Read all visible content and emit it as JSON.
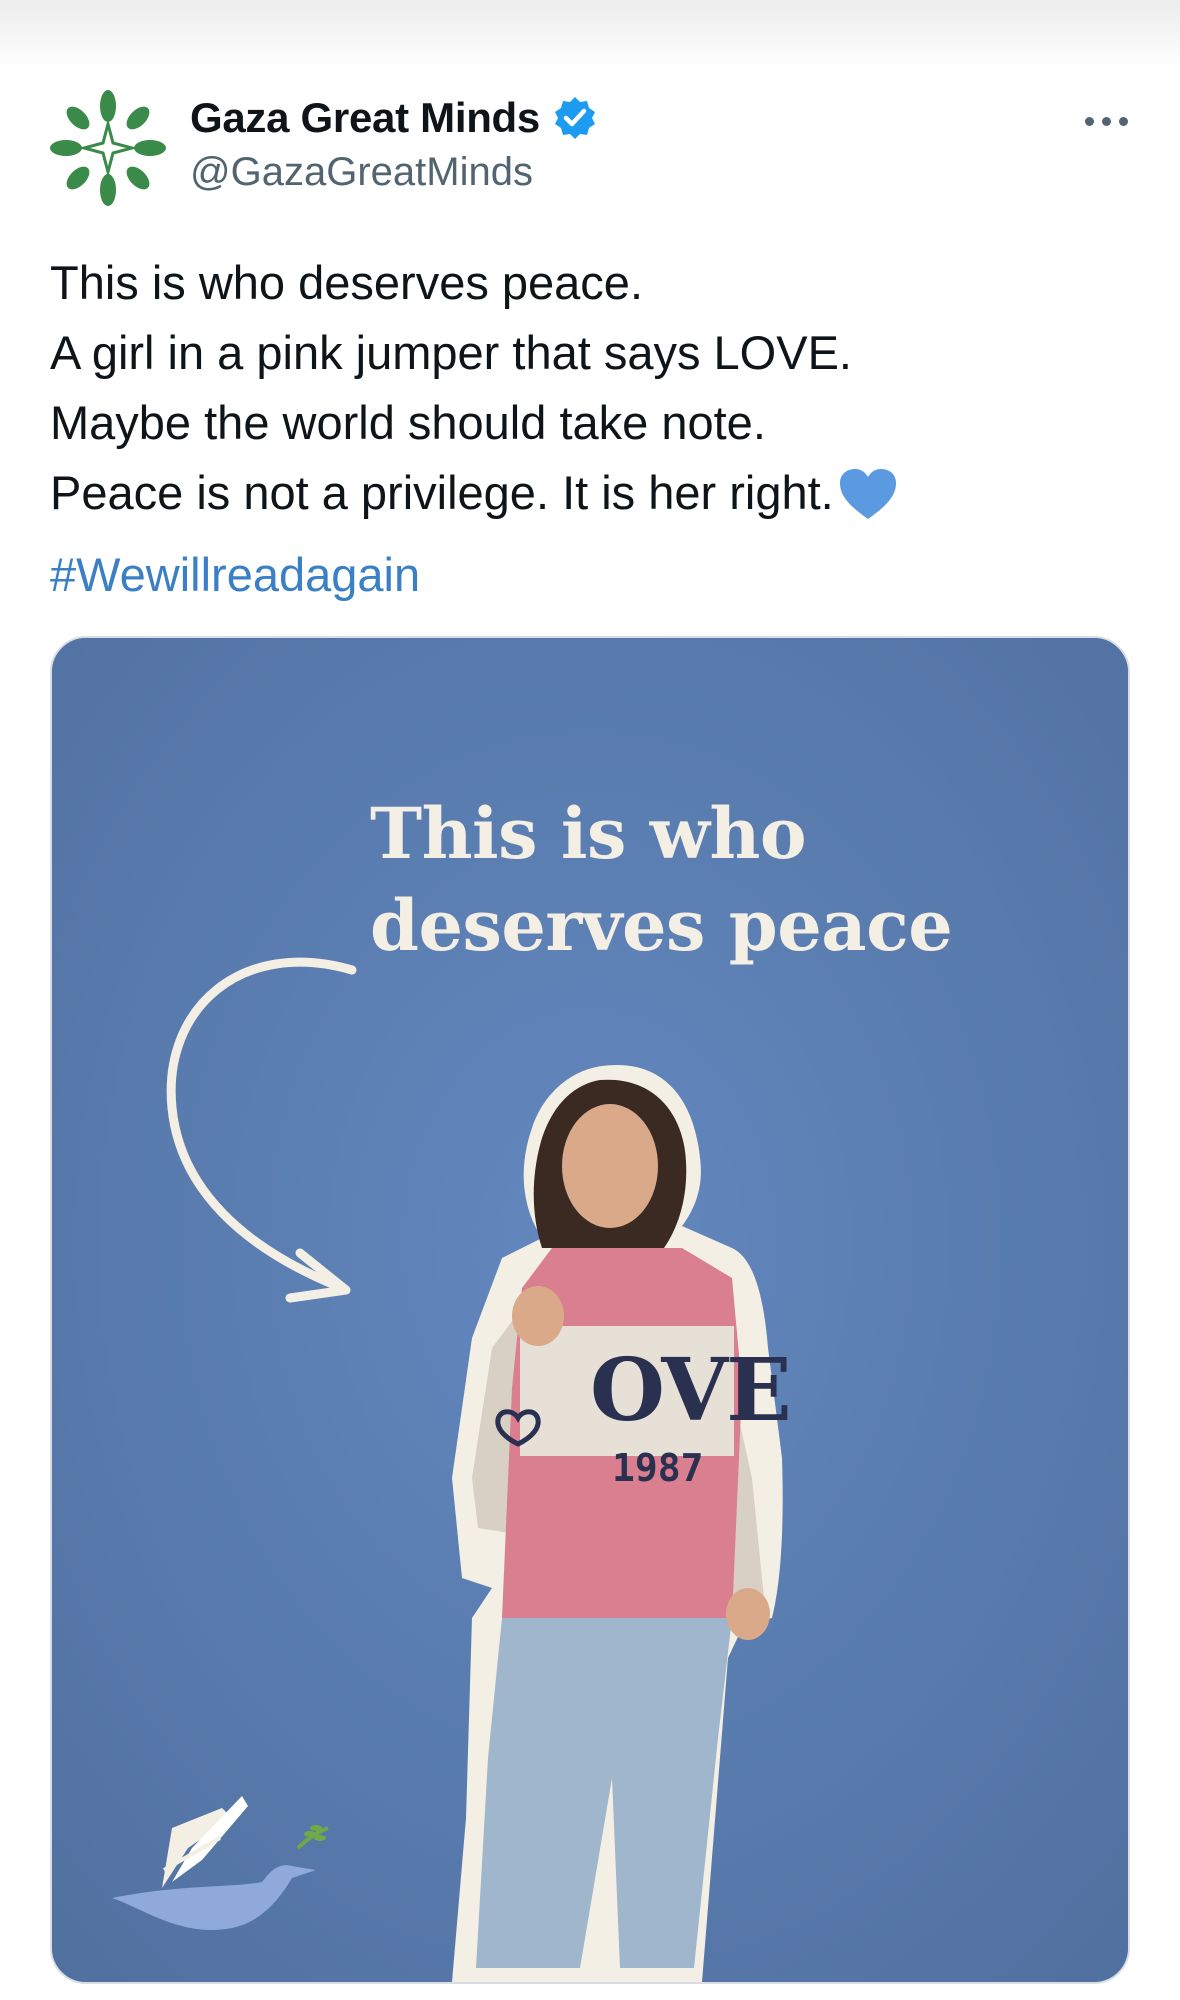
{
  "account": {
    "display_name": "Gaza Great Minds",
    "handle": "@GazaGreatMinds",
    "verified": true,
    "avatar_icon": "green-star-flower-logo",
    "avatar_color": "#3a8a4a"
  },
  "actions": {
    "more_icon": "more-horizontal-icon"
  },
  "tweet": {
    "lines": [
      "This is who deserves peace.",
      "A girl in a pink jumper that says LOVE.",
      "Maybe the world should take note.",
      "Peace is not a privilege. It is her right."
    ],
    "heart_emoji_color": "#5b9ae0",
    "hashtag": "#Wewillreadagain",
    "hashtag_color": "#3b80c7"
  },
  "media": {
    "background_color": "#5a80b8",
    "title_lines": [
      "This is who",
      "deserves peace"
    ],
    "sweater_text": "OVE",
    "sweater_year": "1987",
    "logo_icon": "dove-book-logo"
  }
}
